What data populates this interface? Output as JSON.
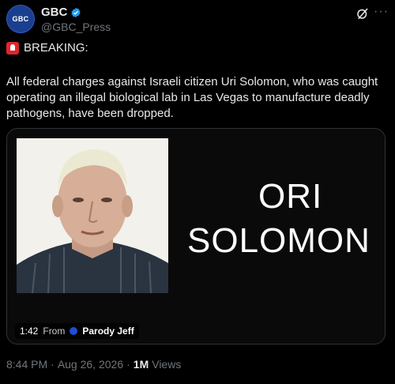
{
  "account": {
    "avatar_text": "GBC",
    "display_name": "GBC",
    "handle": "@GBC_Press"
  },
  "post": {
    "headline": "BREAKING:",
    "text": "All federal charges against Israeli citizen Uri Solomon, who was caught operating an illegal biological lab in Las Vegas to manufacture deadly pathogens, have been dropped."
  },
  "media": {
    "overlay_line1": "ORI",
    "overlay_line2": "SOLOMON",
    "duration": "1:42",
    "from_label": "From",
    "creator": "Parody Jeff"
  },
  "meta": {
    "time": "8:44 PM",
    "separator": "·",
    "date": "Aug 26, 2026",
    "views_count": "1M",
    "views_label": "Views"
  },
  "colors": {
    "background": "#000000",
    "text": "#e7e9ea",
    "muted": "#71767b",
    "verified": "#1d9bf0"
  }
}
